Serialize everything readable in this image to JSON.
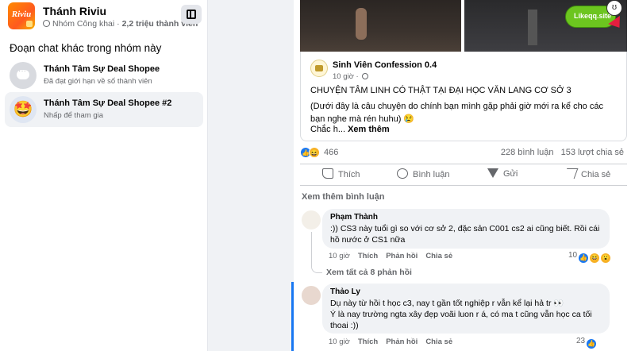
{
  "sidebar": {
    "group_name": "Thánh Riviu",
    "group_logo_text": "Riviu",
    "group_privacy": "Nhóm Công khai",
    "group_members": "2,2 triệu thành viên",
    "section_title": "Đoạn chat khác trong nhóm này",
    "chats": [
      {
        "title": "Thánh Tâm Sự Deal Shopee",
        "subtitle": "Đã đạt giới hạn về số thành viên"
      },
      {
        "title": "Thánh Tâm Sự Deal Shopee #2",
        "subtitle": "Nhấp để tham gia"
      }
    ]
  },
  "post": {
    "shared_page": "Sinh Viên Confession 0.4",
    "shared_time": "10 giờ",
    "headline": "CHUYỆN TÂM LINH CÓ THẬT TẠI ĐẠI HỌC VĂN LANG CƠ SỞ 3",
    "body": "(Dưới đây là câu chuyện do chính bạn mình gặp phải giờ mới ra kể cho các bạn nghe mà rén huhu) 😢",
    "truncated": "Chắc h...",
    "see_more": "Xem thêm",
    "reaction_count": "466",
    "comment_count": "228 bình luận",
    "share_count": "153 lượt chia sẻ",
    "actions": {
      "like": "Thích",
      "comment": "Bình luận",
      "send": "Gửi",
      "share": "Chia sẻ"
    },
    "more_comments": "Xem thêm bình luận"
  },
  "comments": [
    {
      "author": "Phạm Thành",
      "text": ":)) CS3 này tuổi gì so với cơ sở 2, đặc sản C001 cs2 ai cũng biết. Rồi cái hồ nước ở CS1 nữa",
      "time": "10 giờ",
      "like": "Thích",
      "reply": "Phản hồi",
      "share": "Chia sẻ",
      "reactions": "10",
      "view_replies": "Xem tất cả 8 phản hồi"
    },
    {
      "author": "Thảo Ly",
      "text_line1": "Dụ này từ hồi t học c3, nay t gần tốt nghiệp r vẫn kể lại hả tr 👀",
      "text_line2": "Ý là nay trường ngta xây đẹp voãi luon r á, có ma t cũng vẫn học ca tối thoai :))",
      "time": "10 giờ",
      "like": "Thích",
      "reply": "Phản hồi",
      "share": "Chia sẻ",
      "reactions": "23"
    }
  ],
  "promo": {
    "label": "Likeqq.site"
  },
  "icons": {
    "globe": "globe-icon",
    "collapse": "sidebar-collapse-icon",
    "like": "thumb-up-icon",
    "comment": "comment-bubble-icon",
    "send": "send-icon",
    "share": "share-arrow-icon"
  },
  "colors": {
    "accent": "#1877f2",
    "promo_green": "#6cc51f",
    "text_secondary": "#65676b"
  }
}
